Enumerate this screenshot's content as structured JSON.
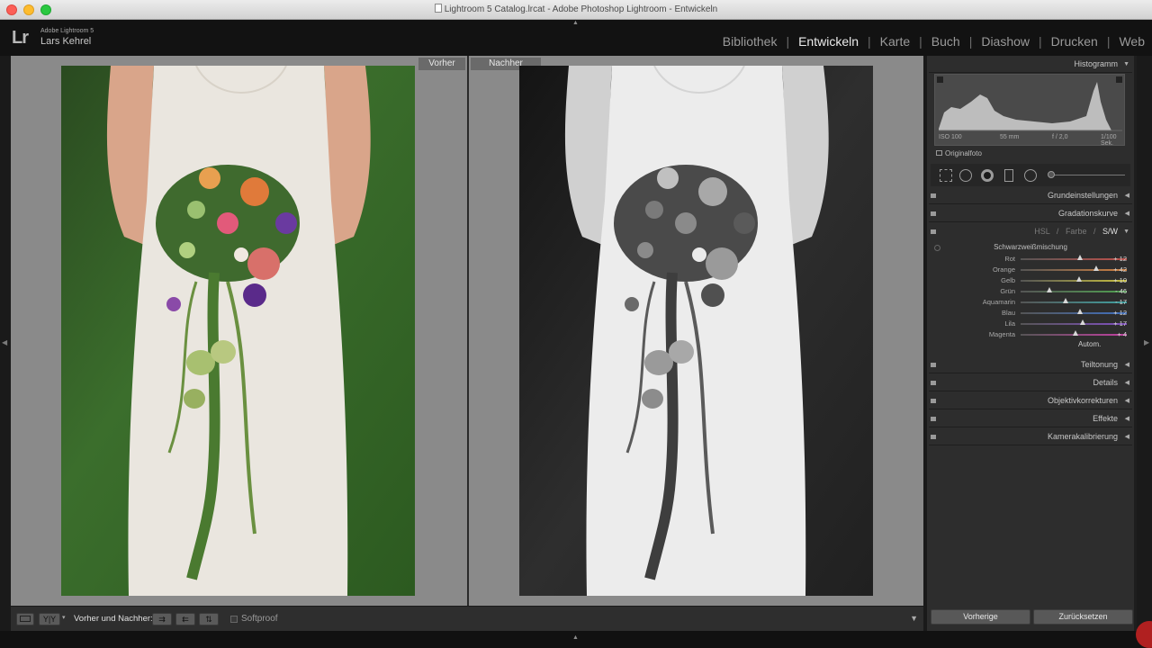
{
  "window": {
    "title": "Lightroom 5 Catalog.lrcat - Adobe Photoshop Lightroom - Entwickeln"
  },
  "identity": {
    "logo": "Lr",
    "product": "Adobe Lightroom 5",
    "user": "Lars Kehrel"
  },
  "modules": [
    "Bibliothek",
    "Entwickeln",
    "Karte",
    "Buch",
    "Diashow",
    "Drucken",
    "Web"
  ],
  "active_module": "Entwickeln",
  "compare": {
    "before_label": "Vorher",
    "after_label": "Nachher"
  },
  "toolbar": {
    "view_mode_label": "Vorher und Nachher:",
    "softproof_label": "Softproof",
    "yy_label": "Y|Y"
  },
  "right_panel": {
    "histogram_title": "Histogramm",
    "iso": "ISO 100",
    "focal": "55 mm",
    "aperture": "f / 2,0",
    "shutter": "1/100 Sek.",
    "original_photo": "Originalfoto",
    "sections_top": [
      "Grundeinstellungen",
      "Gradationskurve"
    ],
    "hsl_tabs": [
      "HSL",
      "Farbe",
      "S/W"
    ],
    "hsl_separator": "/",
    "active_hsl_tab": "S/W",
    "mix_title": "Schwarzweißmischung",
    "mix": [
      {
        "label": "Rot",
        "value": "+ 12",
        "level": 0.56,
        "color": "#c0504a"
      },
      {
        "label": "Orange",
        "value": "+ 42",
        "level": 0.71,
        "color": "#d08040"
      },
      {
        "label": "Gelb",
        "value": "+ 10",
        "level": 0.55,
        "color": "#c8c040"
      },
      {
        "label": "Grün",
        "value": "- 46",
        "level": 0.27,
        "color": "#50a050"
      },
      {
        "label": "Aquamarin",
        "value": "- 17",
        "level": 0.42,
        "color": "#40a0a0"
      },
      {
        "label": "Blau",
        "value": "+ 12",
        "level": 0.56,
        "color": "#4070c0"
      },
      {
        "label": "Lila",
        "value": "+ 17",
        "level": 0.585,
        "color": "#8050c0"
      },
      {
        "label": "Magenta",
        "value": "+ 4",
        "level": 0.52,
        "color": "#c040a0"
      }
    ],
    "autom_label": "Autom.",
    "sections_bottom": [
      "Teiltonung",
      "Details",
      "Objektivkorrekturen",
      "Effekte",
      "Kamerakalibrierung"
    ],
    "previous_button": "Vorherige",
    "reset_button": "Zurücksetzen"
  },
  "colors": {
    "background": "#1a1a1a",
    "panel": "#2d2d2d",
    "view_background": "#8a8a8a"
  }
}
